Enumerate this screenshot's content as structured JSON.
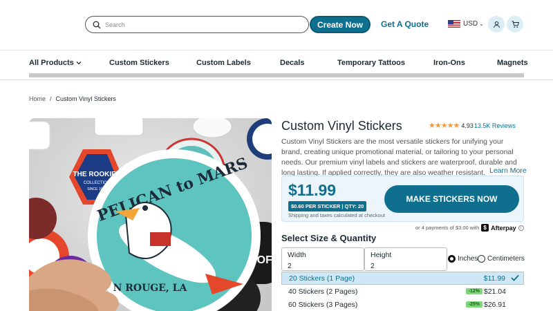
{
  "header": {
    "search_placeholder": "Search",
    "create_button": "Create Now",
    "quote_link": "Get A Quote",
    "currency": "USD"
  },
  "nav": {
    "items": [
      "All Products",
      "Custom Stickers",
      "Custom Labels",
      "Decals",
      "Temporary Tattoos",
      "Iron-Ons",
      "Magnets"
    ]
  },
  "breadcrumb": {
    "home": "Home",
    "separator": "/",
    "current": "Custom Vinyl Stickers"
  },
  "product": {
    "title": "Custom Vinyl Stickers",
    "stars": "★★★★★",
    "rating": "4.93",
    "reviews": "13.5K Reviews",
    "description": "Custom Vinyl Stickers are the most versatile stickers for unifying your brand, creating unique promotional material, or tailoring to your personal needs. Our premium vinyl labels and stickers are waterproof, durable and long lasting. If applied correctly, they are also weather resistant.",
    "learn_more": "Learn More",
    "image_texts": {
      "main_sticker_top": "PELICAN to MARS",
      "main_sticker_bottom": "N ROUGE, LA",
      "hex_sticker": "THE ROOKIES",
      "hex_sub": "COLLECTION",
      "hex_since": "SINCE 1988",
      "dark_sticker": "KILL COFF"
    }
  },
  "pricing": {
    "price": "$11.99",
    "per_sticker": "$0.60 PER STICKER | QTY: 20",
    "tax_note": "Shipping and taxes calculated at checkout",
    "cta": "MAKE STICKERS NOW",
    "afterpay_note": "or 4 payments of $3.00 with",
    "afterpay_brand": "Afterpay",
    "afterpay_logo": "$"
  },
  "size": {
    "heading": "Select Size & Quantity",
    "width_label": "Width",
    "width_value": "2",
    "height_label": "Height",
    "height_value": "2",
    "unit_inches": "Inches",
    "unit_cm": "Centimeters",
    "selected_unit": "Inches"
  },
  "quantities": [
    {
      "label": "20 Stickers (1 Page)",
      "price": "$11.99",
      "discount": "",
      "selected": true
    },
    {
      "label": "40 Stickers (2 Pages)",
      "price": "$21.04",
      "discount": "-12%",
      "selected": false
    },
    {
      "label": "60 Stickers (3 Pages)",
      "price": "$26.91",
      "discount": "-25%",
      "selected": false
    }
  ],
  "colors": {
    "brand": "#0e6f8f",
    "star": "#f09a3e",
    "discount_badge": "#7ed87a",
    "selected_row": "#cfe8f5"
  }
}
